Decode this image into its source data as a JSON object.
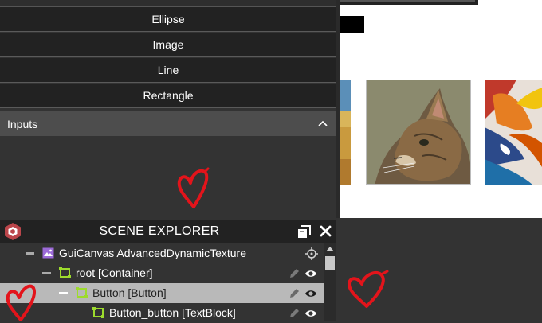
{
  "toolbox": {
    "buttons": [
      {
        "label": "Ellipse"
      },
      {
        "label": "Image"
      },
      {
        "label": "Line"
      },
      {
        "label": "Rectangle"
      }
    ],
    "section": {
      "title": "Inputs",
      "expanded": true,
      "chevron_icon": "chevron-up-icon"
    }
  },
  "scene_explorer": {
    "title": "SCENE EXPLORER",
    "header_icons": [
      "babylon-logo-icon",
      "dock-window-icon",
      "close-icon"
    ],
    "tree": [
      {
        "label": "GuiCanvas AdvancedDynamicTexture",
        "icon": "image-icon",
        "level": 0,
        "actions": [
          "target-icon"
        ],
        "selected": false
      },
      {
        "label": "root [Container]",
        "icon": "container-icon",
        "level": 1,
        "actions": [
          "pen-icon",
          "eye-icon"
        ],
        "selected": false
      },
      {
        "label": "Button [Button]",
        "icon": "container-icon",
        "level": 2,
        "actions": [
          "pen-icon",
          "eye-icon"
        ],
        "selected": true
      },
      {
        "label": "Button_button [TextBlock]",
        "icon": "container-icon",
        "level": 3,
        "actions": [
          "pen-icon",
          "eye-icon"
        ],
        "selected": false
      }
    ]
  },
  "colors": {
    "panel_bg": "#333333",
    "button_bg": "#222222",
    "section_bg": "#4d4d4d",
    "selected_row": "#b9b9b9",
    "gui_icon": "#9c6ad8",
    "control_icon": "#9ddb2d",
    "heart_red": "#e3141b",
    "logo_red": "#bb464b"
  }
}
